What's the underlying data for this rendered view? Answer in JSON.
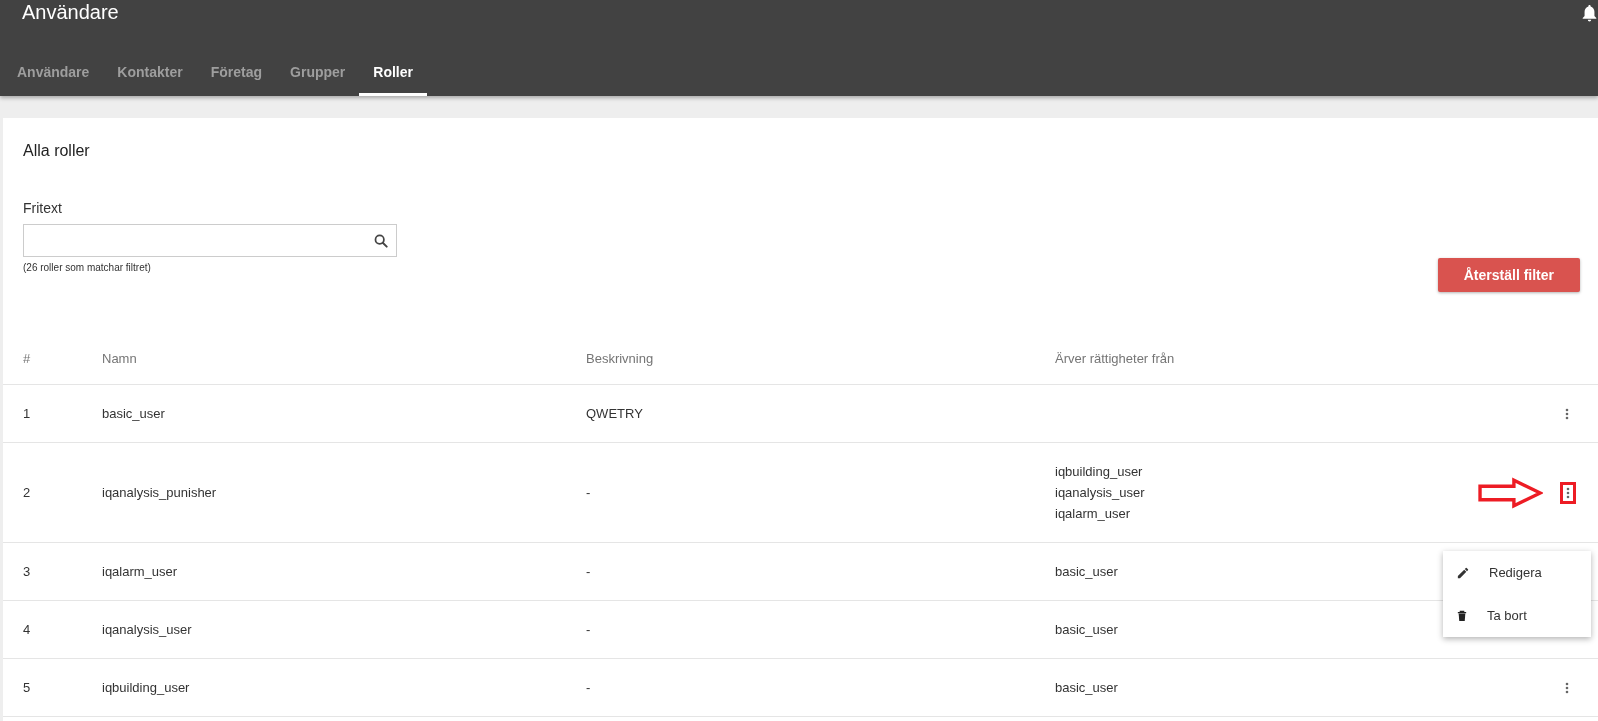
{
  "header": {
    "title": "Användare"
  },
  "tabs": [
    {
      "label": "Användare",
      "selected": false
    },
    {
      "label": "Kontakter",
      "selected": false
    },
    {
      "label": "Företag",
      "selected": false
    },
    {
      "label": "Grupper",
      "selected": false
    },
    {
      "label": "Roller",
      "selected": true
    }
  ],
  "card": {
    "title": "Alla roller"
  },
  "filter": {
    "label": "Fritext",
    "count_text": "(26 roller som matchar filtret)",
    "reset_button": "Återställ filter"
  },
  "table": {
    "columns": [
      "#",
      "Namn",
      "Beskrivning",
      "Ärver rättigheter från"
    ],
    "rows": [
      {
        "number": "1",
        "name": "basic_user",
        "description": "QWETRY",
        "inherits": [],
        "highlighted": false
      },
      {
        "number": "2",
        "name": "iqanalysis_punisher",
        "description": "-",
        "inherits": [
          "iqbuilding_user",
          "iqanalysis_user",
          "iqalarm_user"
        ],
        "highlighted": true
      },
      {
        "number": "3",
        "name": "iqalarm_user",
        "description": "-",
        "inherits": [
          "basic_user"
        ],
        "highlighted": false
      },
      {
        "number": "4",
        "name": "iqanalysis_user",
        "description": "-",
        "inherits": [
          "basic_user"
        ],
        "highlighted": false
      },
      {
        "number": "5",
        "name": "iqbuilding_user",
        "description": "-",
        "inherits": [
          "basic_user"
        ],
        "highlighted": false
      }
    ]
  },
  "context_menu": {
    "items": [
      {
        "kind": "edit",
        "label": "Redigera"
      },
      {
        "kind": "delete",
        "label": "Ta bort"
      }
    ]
  }
}
